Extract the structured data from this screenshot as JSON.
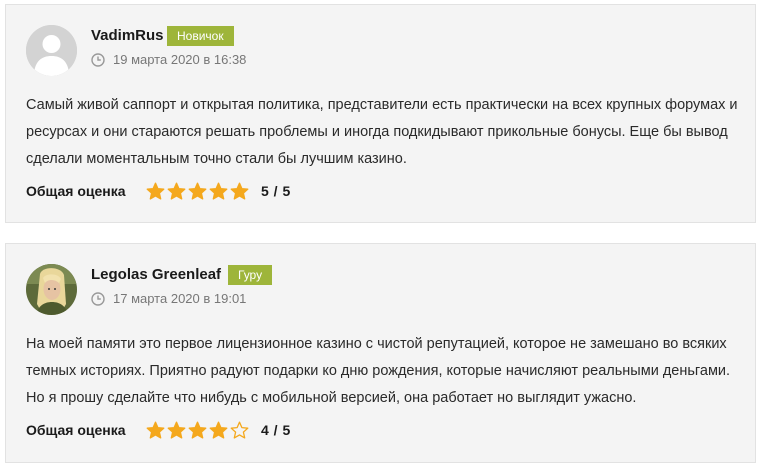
{
  "colors": {
    "badge": "#9eb53a",
    "star": "#f4a81d",
    "card_bg": "#f4f4f4"
  },
  "reviews": [
    {
      "author": "VadimRus",
      "badge": "Новичок",
      "date": "19 марта 2020 в 16:38",
      "avatar": "default-user-icon",
      "text": "Самый живой саппорт и открытая политика, представители есть практически на всех крупных форумах и ресурсах и они стараются решать проблемы и иногда подкидывают прикольные бонусы. Еще бы вывод сделали моментальным точно стали бы лучшим казино.",
      "rating_label": "Общая оценка",
      "rating": 5,
      "rating_max": 5,
      "score": "5 / 5"
    },
    {
      "author": "Legolas Greenleaf",
      "badge": "Гуру",
      "date": "17 марта 2020 в 19:01",
      "avatar": "user-photo",
      "text": "На моей памяти это первое лицензионное казино с чистой репутацией, которое не замешано во всяких темных историях. Приятно радуют подарки ко дню рождения, которые начисляют реальными деньгами. Но я прошу сделайте что нибудь с мобильной версией, она работает но выглядит ужасно.",
      "rating_label": "Общая оценка",
      "rating": 4,
      "rating_max": 5,
      "score": "4 / 5"
    }
  ]
}
